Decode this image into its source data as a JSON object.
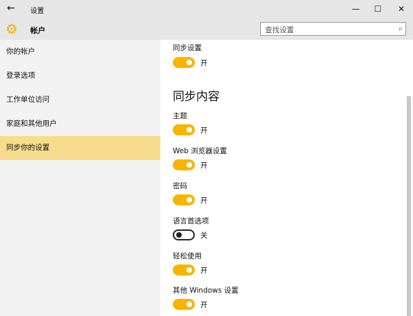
{
  "window": {
    "title": "设置",
    "back": "←",
    "minimize": "—",
    "maximize": "☐",
    "close": "✕"
  },
  "header": {
    "title": "帐户",
    "search_placeholder": "查找设置",
    "search_icon": "⌕"
  },
  "sidebar": {
    "items": [
      {
        "label": "你的帐户"
      },
      {
        "label": "登录选项"
      },
      {
        "label": "工作单位访问"
      },
      {
        "label": "家庭和其他用户"
      },
      {
        "label": "同步你的设置",
        "selected": true
      }
    ]
  },
  "main": {
    "sync": {
      "label": "同步设置",
      "state": "开",
      "on": true
    },
    "heading": "同步内容",
    "items": [
      {
        "label": "主题",
        "state": "开",
        "on": true
      },
      {
        "label": "Web 浏览器设置",
        "state": "开",
        "on": true
      },
      {
        "label": "密码",
        "state": "开",
        "on": true
      },
      {
        "label": "语言首选项",
        "state": "关",
        "on": false
      },
      {
        "label": "轻松使用",
        "state": "开",
        "on": true
      },
      {
        "label": "其他 Windows 设置",
        "state": "开",
        "on": true
      }
    ]
  },
  "colors": {
    "accent": "#f7b500",
    "selected": "#f8dc8e"
  }
}
